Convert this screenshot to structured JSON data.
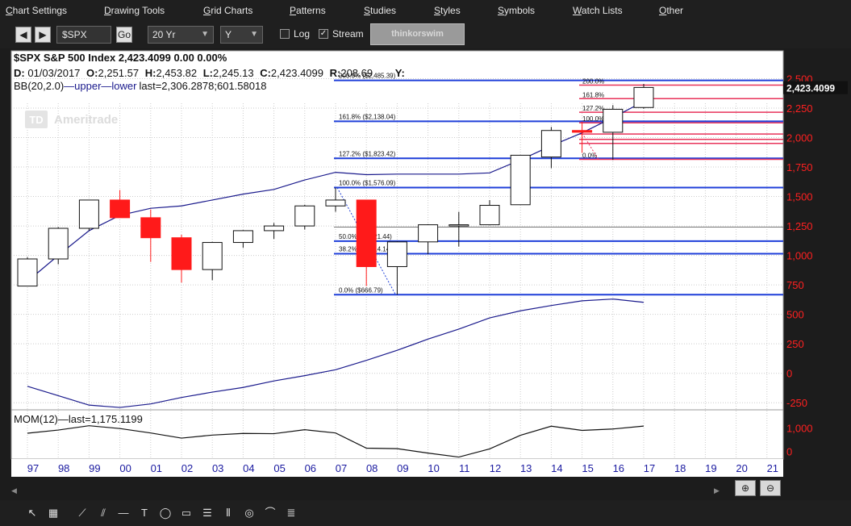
{
  "menu": {
    "items": [
      {
        "key": "C",
        "rest": "hart Settings"
      },
      {
        "key": "D",
        "rest": "rawing Tools"
      },
      {
        "key": "G",
        "rest": "rid Charts"
      },
      {
        "key": "P",
        "rest": "atterns"
      },
      {
        "key": "S",
        "rest": "tudies"
      },
      {
        "key": "S",
        "rest": "tyles"
      },
      {
        "key": "S",
        "rest": "ymbols"
      },
      {
        "key": "W",
        "rest": "atch Lists"
      },
      {
        "key": "O",
        "rest": "ther"
      }
    ]
  },
  "toolbar": {
    "back_icon": "triangle-left-icon",
    "forward_icon": "triangle-right-icon",
    "symbol_value": "$SPX",
    "go_label": "Go",
    "period_value": "20 Yr",
    "aggregation_value": "Y",
    "log_label": "Log",
    "log_checked": false,
    "stream_label": "Stream",
    "stream_checked": true,
    "brand_label": "thinkorswim"
  },
  "header": {
    "line1": "$SPX S&P 500 Index  2,423.4099  0.00  0.00%",
    "line2_prefix": "D: ",
    "date": "01/03/2017",
    "open_label": "O:",
    "open": "2,251.57",
    "high_label": "H:",
    "high": "2,453.82",
    "low_label": "L:",
    "low": "2,245.13",
    "close_label": "C:",
    "close": "2,423.4099",
    "range_label": "R:",
    "range": "208.69",
    "y_label": "Y:",
    "bb_text": "BB(20,2.0)",
    "bb_upper": "upper",
    "bb_lower": "lower",
    "bb_last": "last=2,306.2878;601.58018",
    "watermark": "Ameritrade",
    "watermark_logo": "TD"
  },
  "lower_panel": {
    "label": "MOM(12)",
    "last": "last=1,175.1199",
    "ticks": [
      "1,000",
      "0"
    ]
  },
  "colors": {
    "up_candle": "#ffffff",
    "down_candle": "#ff1a1a",
    "bb_line": "#1a1a8c",
    "fib_blue": "#1f3fd9",
    "fib_red": "#e8335a",
    "axis_text": "#ff2020",
    "x_text": "#1a1aa0",
    "grid": "#cccccc"
  },
  "chart_data": {
    "type": "candlestick",
    "y_axis": {
      "ylim": [
        -310,
        2640
      ],
      "ticks": [
        -250,
        0,
        250,
        500,
        750,
        1000,
        1250,
        1500,
        1750,
        2000,
        2250,
        2500
      ],
      "tick_labels": [
        "-250",
        "0",
        "250",
        "500",
        "750",
        "1,000",
        "1,250",
        "1,500",
        "1,750",
        "2,000",
        "2,250",
        "2,500"
      ]
    },
    "x_axis": {
      "tick_labels": [
        "97",
        "98",
        "99",
        "00",
        "01",
        "02",
        "03",
        "04",
        "05",
        "06",
        "07",
        "08",
        "09",
        "10",
        "11",
        "12",
        "13",
        "14",
        "15",
        "16",
        "17",
        "18",
        "19",
        "20",
        "21"
      ]
    },
    "price_label": "2,423.4099",
    "price_value": 2423.41,
    "candles": [
      {
        "year": "97",
        "open": 740,
        "high": 985,
        "low": 740,
        "close": 970
      },
      {
        "year": "98",
        "open": 970,
        "high": 1240,
        "low": 925,
        "close": 1230
      },
      {
        "year": "99",
        "open": 1230,
        "high": 1470,
        "low": 1210,
        "close": 1470
      },
      {
        "year": "00",
        "open": 1470,
        "high": 1555,
        "low": 1320,
        "close": 1320
      },
      {
        "year": "01",
        "open": 1320,
        "high": 1390,
        "low": 945,
        "close": 1150
      },
      {
        "year": "02",
        "open": 1150,
        "high": 1175,
        "low": 770,
        "close": 880
      },
      {
        "year": "03",
        "open": 880,
        "high": 1115,
        "low": 790,
        "close": 1110
      },
      {
        "year": "04",
        "open": 1110,
        "high": 1215,
        "low": 1065,
        "close": 1210
      },
      {
        "year": "05",
        "open": 1210,
        "high": 1275,
        "low": 1140,
        "close": 1250
      },
      {
        "year": "06",
        "open": 1250,
        "high": 1430,
        "low": 1220,
        "close": 1420
      },
      {
        "year": "07",
        "open": 1420,
        "high": 1575,
        "low": 1370,
        "close": 1470
      },
      {
        "year": "08",
        "open": 1470,
        "high": 1470,
        "low": 740,
        "close": 905
      },
      {
        "year": "09",
        "open": 905,
        "high": 1120,
        "low": 667,
        "close": 1115
      },
      {
        "year": "10",
        "open": 1115,
        "high": 1265,
        "low": 1010,
        "close": 1260
      },
      {
        "year": "11",
        "open": 1260,
        "high": 1370,
        "low": 1075,
        "close": 1260
      },
      {
        "year": "12",
        "open": 1260,
        "high": 1470,
        "low": 1255,
        "close": 1425
      },
      {
        "year": "13",
        "open": 1430,
        "high": 1850,
        "low": 1430,
        "close": 1850
      },
      {
        "year": "14",
        "open": 1835,
        "high": 2090,
        "low": 1740,
        "close": 2060
      },
      {
        "year": "15",
        "open": 2060,
        "high": 2135,
        "low": 1870,
        "close": 2045
      },
      {
        "year": "16",
        "open": 2045,
        "high": 2275,
        "low": 1810,
        "close": 2240
      },
      {
        "year": "17",
        "open": 2255,
        "high": 2455,
        "low": 2245,
        "close": 2425
      }
    ],
    "bb_upper": [
      {
        "year": "97",
        "value": 780
      },
      {
        "year": "98",
        "value": 1000
      },
      {
        "year": "99",
        "value": 1210
      },
      {
        "year": "00",
        "value": 1340
      },
      {
        "year": "01",
        "value": 1400
      },
      {
        "year": "02",
        "value": 1420
      },
      {
        "year": "03",
        "value": 1470
      },
      {
        "year": "04",
        "value": 1520
      },
      {
        "year": "05",
        "value": 1560
      },
      {
        "year": "06",
        "value": 1640
      },
      {
        "year": "07",
        "value": 1705
      },
      {
        "year": "08",
        "value": 1685
      },
      {
        "year": "09",
        "value": 1690
      },
      {
        "year": "10",
        "value": 1690
      },
      {
        "year": "11",
        "value": 1690
      },
      {
        "year": "12",
        "value": 1700
      },
      {
        "year": "13",
        "value": 1810
      },
      {
        "year": "14",
        "value": 1930
      },
      {
        "year": "15",
        "value": 2040
      },
      {
        "year": "16",
        "value": 2170
      },
      {
        "year": "17",
        "value": 2306
      }
    ],
    "bb_lower": [
      {
        "year": "97",
        "value": -110
      },
      {
        "year": "98",
        "value": -190
      },
      {
        "year": "99",
        "value": -270
      },
      {
        "year": "00",
        "value": -290
      },
      {
        "year": "01",
        "value": -260
      },
      {
        "year": "02",
        "value": -205
      },
      {
        "year": "03",
        "value": -160
      },
      {
        "year": "04",
        "value": -120
      },
      {
        "year": "05",
        "value": -65
      },
      {
        "year": "06",
        "value": -20
      },
      {
        "year": "07",
        "value": 30
      },
      {
        "year": "08",
        "value": 110
      },
      {
        "year": "09",
        "value": 195
      },
      {
        "year": "10",
        "value": 290
      },
      {
        "year": "11",
        "value": 375
      },
      {
        "year": "12",
        "value": 470
      },
      {
        "year": "13",
        "value": 530
      },
      {
        "year": "14",
        "value": 575
      },
      {
        "year": "15",
        "value": 615
      },
      {
        "year": "16",
        "value": 630
      },
      {
        "year": "17",
        "value": 602
      }
    ],
    "momentum": [
      {
        "year": "97",
        "value": 770
      },
      {
        "year": "98",
        "value": 905
      },
      {
        "year": "99",
        "value": 1090
      },
      {
        "year": "00",
        "value": 970
      },
      {
        "year": "01",
        "value": 780
      },
      {
        "year": "02",
        "value": 560
      },
      {
        "year": "03",
        "value": 690
      },
      {
        "year": "04",
        "value": 760
      },
      {
        "year": "05",
        "value": 750
      },
      {
        "year": "06",
        "value": 920
      },
      {
        "year": "07",
        "value": 780
      },
      {
        "year": "08",
        "value": 130
      },
      {
        "year": "09",
        "value": 110
      },
      {
        "year": "10",
        "value": -80
      },
      {
        "year": "11",
        "value": -250
      },
      {
        "year": "12",
        "value": 100
      },
      {
        "year": "13",
        "value": 680
      },
      {
        "year": "14",
        "value": 1070
      },
      {
        "year": "15",
        "value": 890
      },
      {
        "year": "16",
        "value": 950
      },
      {
        "year": "17",
        "value": 1075
      }
    ],
    "mom_ylim": [
      -300,
      1700
    ],
    "fib_blue": [
      {
        "pct": "200.0%",
        "price": "($2,485.39)",
        "value": 2485.39
      },
      {
        "pct": "161.8%",
        "price": "($2,138.04)",
        "value": 2138.04
      },
      {
        "pct": "127.2%",
        "price": "($1,823.42)",
        "value": 1823.42
      },
      {
        "pct": "100.0%",
        "price": "($1,576.09)",
        "value": 1576.09
      },
      {
        "pct": "50.0%",
        "price": "($1,121.44)",
        "value": 1121.44
      },
      {
        "pct": "38.2%",
        "price": "($1,014.14)",
        "value": 1014.14
      },
      {
        "pct": "0.0%",
        "price": "($666.79)",
        "value": 666.79
      }
    ],
    "fib_blue_thin": [
      1240
    ],
    "fib_red": [
      {
        "pct": "200.0%",
        "value": 2445
      },
      {
        "pct": "161.8%",
        "value": 2330
      },
      {
        "pct": "127.2%",
        "value": 2215
      },
      {
        "pct": "100.0%",
        "value": 2125
      },
      {
        "pct": "",
        "value": 2030
      },
      {
        "pct": "",
        "value": 1985
      },
      {
        "pct": "",
        "value": 1950
      },
      {
        "pct": "0.0%",
        "value": 1815
      }
    ]
  }
}
